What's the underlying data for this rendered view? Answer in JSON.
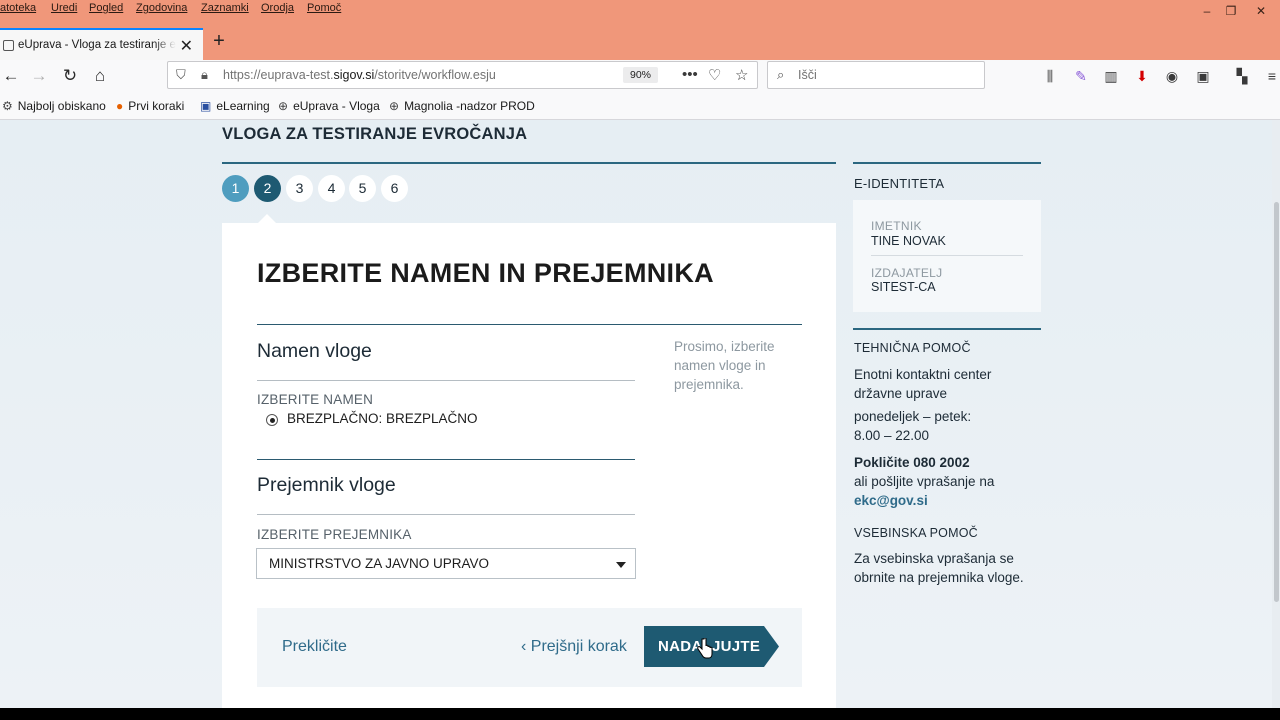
{
  "browser": {
    "menu": [
      "atoteka",
      "Uredi",
      "Pogled",
      "Zgodovina",
      "Zaznamki",
      "Orodja",
      "Pomoč"
    ],
    "tab_title": "eUprava - Vloga za testiranje eV",
    "url_prefix": "https://euprava-test.",
    "url_domain": "sigov.si",
    "url_path": "/storitve/workflow.esju",
    "zoom": "90%",
    "search_placeholder": "Išči",
    "bookmarks": [
      "Najbolj obiskano",
      "Prvi koraki",
      "eLearning",
      "eUprava - Vloga",
      "Magnolia -nadzor PROD"
    ]
  },
  "page": {
    "title": "VLOGA ZA TESTIRANJE EVROČANJA",
    "steps": [
      "1",
      "2",
      "3",
      "4",
      "5",
      "6"
    ],
    "current_step": 2,
    "heading": "IZBERITE NAMEN IN PREJEMNIKA",
    "hint": "Prosimo, izberite namen vloge in prejemnika.",
    "purpose": {
      "section_title": "Namen vloge",
      "label": "IZBERITE NAMEN",
      "option": "BREZPLAČNO: BREZPLAČNO"
    },
    "recipient": {
      "section_title": "Prejemnik vloge",
      "label": "IZBERITE PREJEMNIKA",
      "selected": "MINISTRSTVO ZA JAVNO UPRAVO"
    },
    "actions": {
      "cancel": "Prekličite",
      "prev": "Prejšnji korak",
      "prev_arrow": "‹",
      "next": "NADALJUJTE"
    }
  },
  "sidebar": {
    "eid_title": "E-IDENTITETA",
    "holder_label": "IMETNIK",
    "holder_value": "TINE NOVAK",
    "issuer_label": "IZDAJATELJ",
    "issuer_value": "SITEST-CA",
    "tech_title": "TEHNIČNA POMOČ",
    "tech_line1": "Enotni kontaktni center državne uprave",
    "tech_line2": "ponedeljek – petek: 8.00 – 22.00",
    "tech_call": "Pokličite 080 2002",
    "tech_or": "ali pošljite vprašanje na",
    "tech_email": "ekc@gov.si",
    "content_title": "VSEBINSKA POMOČ",
    "content_text": "Za vsebinska vprašanja se obrnite na prejemnika vloge."
  },
  "colors": {
    "accent": "#1e5a72",
    "step_done": "#4f9dbf",
    "link": "#2f6b8a",
    "titlebar": "#f0977a"
  }
}
